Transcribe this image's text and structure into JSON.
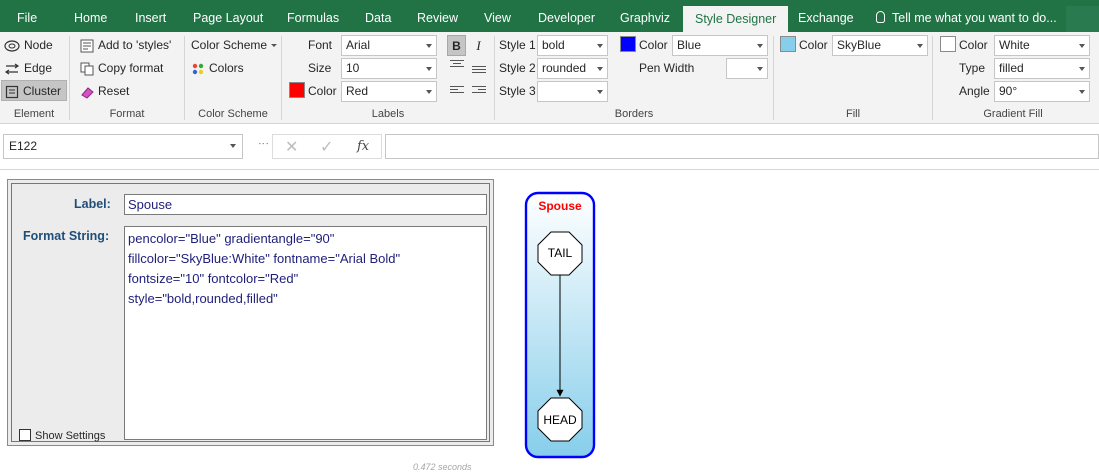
{
  "tabs": [
    "File",
    "Home",
    "Insert",
    "Page Layout",
    "Formulas",
    "Data",
    "Review",
    "View",
    "Developer",
    "Graphviz",
    "Style Designer",
    "Exchange"
  ],
  "active_tab": "Style Designer",
  "tell_me": "Tell me what you want to do...",
  "ribbon": {
    "element": {
      "items": [
        "Node",
        "Edge",
        "Cluster"
      ],
      "selected": "Cluster",
      "group_label": "Element"
    },
    "format": {
      "add_to_styles": "Add to 'styles'",
      "copy_format": "Copy format",
      "reset": "Reset",
      "group_label": "Format"
    },
    "color_scheme": {
      "color_scheme": "Color Scheme",
      "colors": "Colors",
      "group_label": "Color Scheme"
    },
    "labels": {
      "font_label": "Font",
      "font_value": "Arial",
      "size_label": "Size",
      "size_value": "10",
      "color_label": "Color",
      "color_value": "Red",
      "color_hex": "#ff0000",
      "bold": "B",
      "italic": "I",
      "group_label": "Labels"
    },
    "borders": {
      "style1_label": "Style 1",
      "style1_value": "bold",
      "style2_label": "Style 2",
      "style2_value": "rounded",
      "style3_label": "Style 3",
      "style3_value": "",
      "color_label": "Color",
      "color_value": "Blue",
      "color_hex": "#0000ff",
      "pen_width_label": "Pen Width",
      "pen_width_value": "",
      "group_label": "Borders"
    },
    "fill": {
      "color_label": "Color",
      "color_value": "SkyBlue",
      "color_hex": "#87ceeb",
      "group_label": "Fill"
    },
    "gradient_fill": {
      "color_label": "Color",
      "color_value": "White",
      "color_hex": "#ffffff",
      "type_label": "Type",
      "type_value": "filled",
      "angle_label": "Angle",
      "angle_value": "90°",
      "group_label": "Gradient Fill"
    }
  },
  "formula_bar": {
    "name_box": "E122",
    "cancel": "✕",
    "enter": "✓",
    "fx": "fx",
    "formula": ""
  },
  "designer": {
    "label_caption": "Label:",
    "label_value": "Spouse",
    "format_caption": "Format String:",
    "format_lines": [
      "pencolor=\"Blue\" gradientangle=\"90\"",
      "fillcolor=\"SkyBlue:White\" fontname=\"Arial Bold\"",
      "fontsize=\"10\" fontcolor=\"Red\"",
      "style=\"bold,rounded,filled\""
    ],
    "show_settings": "Show Settings"
  },
  "timer": "0.472 seconds",
  "graph": {
    "cluster_label": "Spouse",
    "cluster_label_color": "#ff0000",
    "pen_color": "#0000ff",
    "fill_color": "#87ceeb",
    "gradient_color": "#ffffff",
    "nodes": [
      "TAIL",
      "HEAD"
    ]
  }
}
